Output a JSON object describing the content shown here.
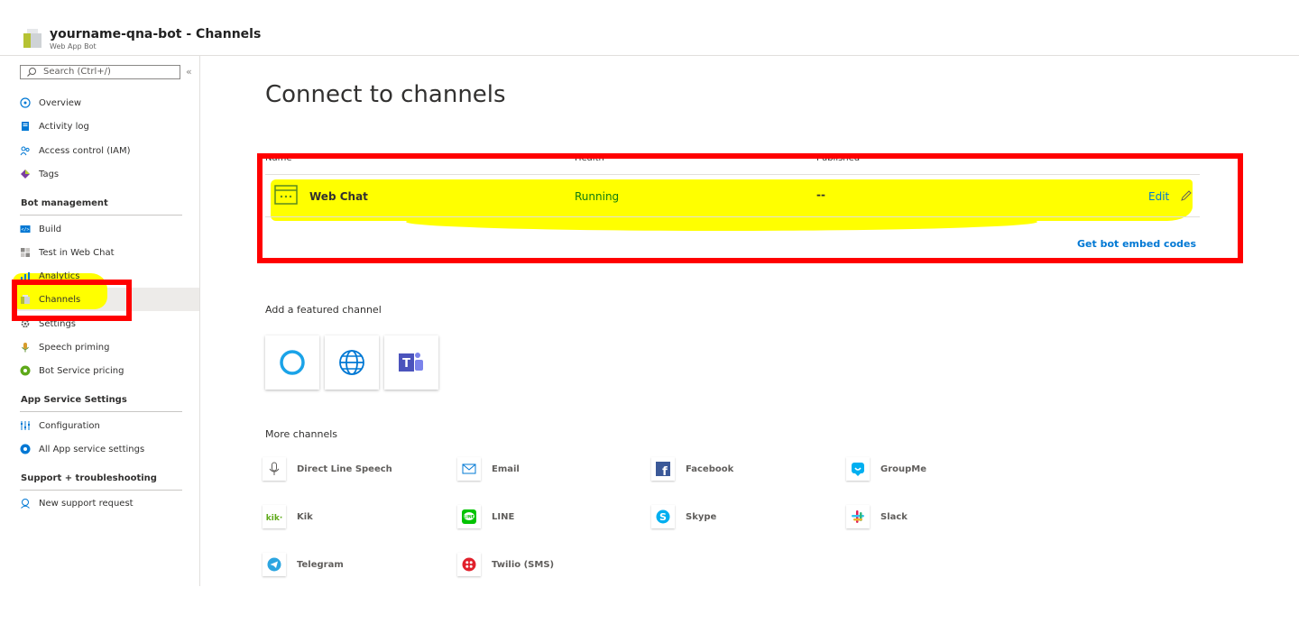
{
  "header": {
    "title": "yourname-qna-bot - Channels",
    "subtitle": "Web App Bot"
  },
  "sidebar": {
    "search_placeholder": "Search (Ctrl+/)",
    "collapse_glyph": "«",
    "top_items": [
      {
        "label": "Overview",
        "icon": "overview-icon"
      },
      {
        "label": "Activity log",
        "icon": "activity-log-icon"
      },
      {
        "label": "Access control (IAM)",
        "icon": "people-icon"
      },
      {
        "label": "Tags",
        "icon": "tag-icon"
      }
    ],
    "sections": [
      {
        "title": "Bot management",
        "items": [
          {
            "label": "Build",
            "icon": "code-icon"
          },
          {
            "label": "Test in Web Chat",
            "icon": "grid-icon"
          },
          {
            "label": "Analytics",
            "icon": "chart-icon"
          },
          {
            "label": "Channels",
            "icon": "cube-icon",
            "active": true
          },
          {
            "label": "Settings",
            "icon": "gear-icon"
          },
          {
            "label": "Speech priming",
            "icon": "microphone-icon"
          },
          {
            "label": "Bot Service pricing",
            "icon": "pricing-icon"
          }
        ]
      },
      {
        "title": "App Service Settings",
        "items": [
          {
            "label": "Configuration",
            "icon": "sliders-icon"
          },
          {
            "label": "All App service settings",
            "icon": "globe-gear-icon"
          }
        ]
      },
      {
        "title": "Support + troubleshooting",
        "items": [
          {
            "label": "New support request",
            "icon": "support-icon"
          }
        ]
      }
    ]
  },
  "main": {
    "title": "Connect to channels",
    "table": {
      "columns": [
        "Name",
        "Health",
        "Published"
      ],
      "rows": [
        {
          "name": "Web Chat",
          "health": "Running",
          "published": "--",
          "action": "Edit"
        }
      ],
      "embed_link": "Get bot embed codes"
    },
    "featured_title": "Add a featured channel",
    "featured": [
      {
        "icon": "cortana-icon"
      },
      {
        "icon": "globe-icon"
      },
      {
        "icon": "teams-icon"
      }
    ],
    "more_title": "More channels",
    "more": [
      {
        "label": "Direct Line Speech",
        "icon": "microphone-icon"
      },
      {
        "label": "Email",
        "icon": "email-icon"
      },
      {
        "label": "Facebook",
        "icon": "facebook-icon"
      },
      {
        "label": "GroupMe",
        "icon": "groupme-icon"
      },
      {
        "label": "Kik",
        "icon": "kik-icon"
      },
      {
        "label": "LINE",
        "icon": "line-icon"
      },
      {
        "label": "Skype",
        "icon": "skype-icon"
      },
      {
        "label": "Slack",
        "icon": "slack-icon"
      },
      {
        "label": "Telegram",
        "icon": "telegram-icon"
      },
      {
        "label": "Twilio (SMS)",
        "icon": "twilio-icon"
      }
    ]
  },
  "colors": {
    "accent": "#0078d4",
    "running": "#107c10",
    "highlight": "#ffff00",
    "annotation": "#ff0000"
  }
}
